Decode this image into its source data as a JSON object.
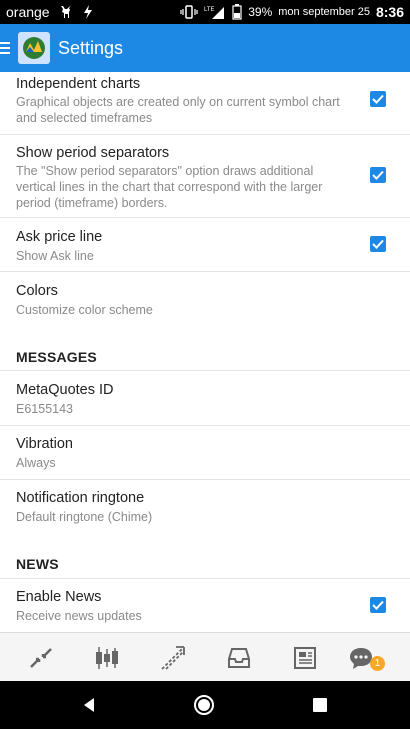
{
  "status_bar": {
    "carrier": "orange",
    "signal": "LTE",
    "battery": "39%",
    "date": "mon september 25",
    "time": "8:36"
  },
  "app_bar": {
    "title": "Settings"
  },
  "settings": [
    {
      "title": "Independent charts",
      "subtitle": "Graphical objects are created only on current symbol chart and selected timeframes",
      "checked": true
    },
    {
      "title": "Show period separators",
      "subtitle": "The \"Show period separators\" option draws additional vertical lines in the chart that correspond with the larger period (timeframe) borders.",
      "checked": true
    },
    {
      "title": "Ask price line",
      "subtitle": "Show Ask line",
      "checked": true
    },
    {
      "title": "Colors",
      "subtitle": "Customize color scheme"
    }
  ],
  "messages": {
    "header": "MESSAGES",
    "items": [
      {
        "title": "MetaQuotes ID",
        "subtitle": "E6155143"
      },
      {
        "title": "Vibration",
        "subtitle": "Always"
      },
      {
        "title": "Notification ringtone",
        "subtitle": "Default ringtone (Chime)"
      }
    ]
  },
  "news": {
    "header": "NEWS",
    "items": [
      {
        "title": "Enable News",
        "subtitle": "Receive news updates",
        "checked": true
      }
    ]
  },
  "bottom_nav": {
    "items": [
      "quotes-icon",
      "chart-icon",
      "trade-icon",
      "history-icon",
      "news-icon",
      "chat-icon"
    ],
    "chat_badge": "1"
  },
  "colors": {
    "accent": "#1e88e5",
    "badge": "#f9a825"
  }
}
